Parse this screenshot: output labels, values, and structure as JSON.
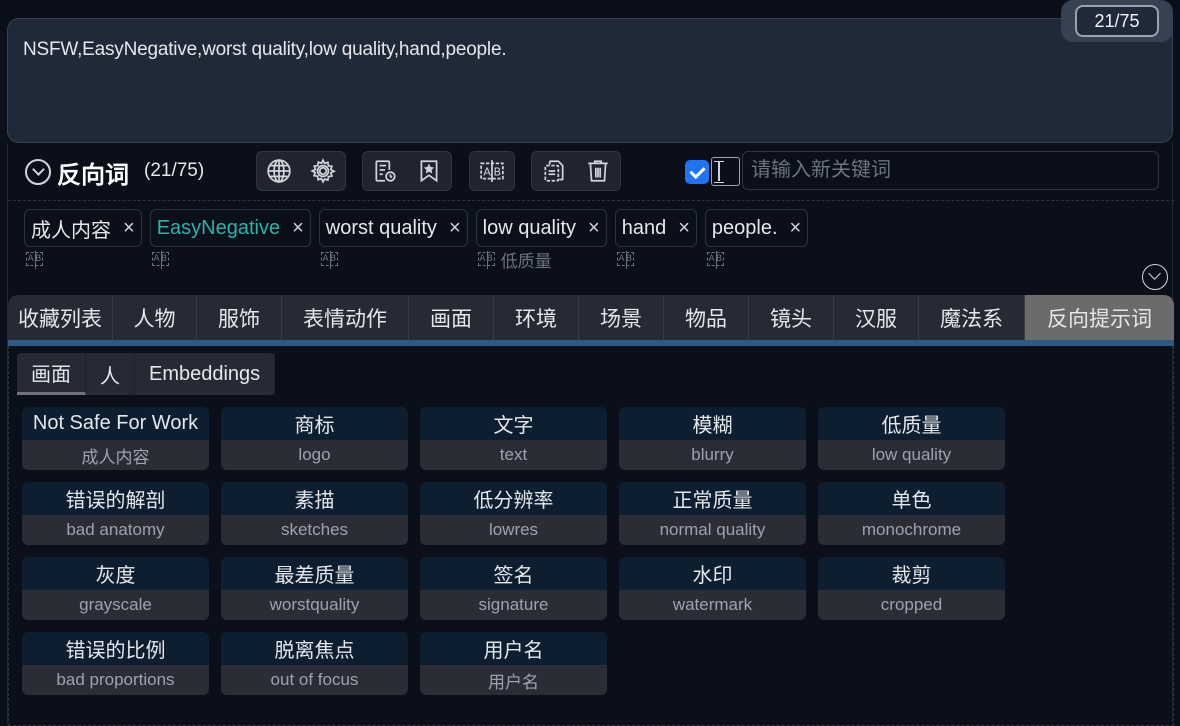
{
  "prompt": {
    "text": "NSFW,EasyNegative,worst quality,low quality,hand,people.",
    "counter": "21/75"
  },
  "header": {
    "title": "反向词",
    "count": "(21/75)",
    "input_placeholder": "请输入新关键词",
    "checkbox_checked": true
  },
  "tags": [
    {
      "label": "成人内容",
      "translation": "",
      "embedding": false
    },
    {
      "label": "EasyNegative",
      "translation": "",
      "embedding": true
    },
    {
      "label": "worst quality",
      "translation": "",
      "embedding": false
    },
    {
      "label": "low quality",
      "translation": "低质量",
      "embedding": false
    },
    {
      "label": "hand",
      "translation": "",
      "embedding": false
    },
    {
      "label": "people.",
      "translation": "",
      "embedding": false
    }
  ],
  "tag_close": "×",
  "ab_icon": {
    "a": "A",
    "b": "B"
  },
  "categories": [
    {
      "label": "收藏列表",
      "active": false
    },
    {
      "label": "人物",
      "active": false
    },
    {
      "label": "服饰",
      "active": false
    },
    {
      "label": "表情动作",
      "active": false
    },
    {
      "label": "画面",
      "active": false
    },
    {
      "label": "环境",
      "active": false
    },
    {
      "label": "场景",
      "active": false
    },
    {
      "label": "物品",
      "active": false
    },
    {
      "label": "镜头",
      "active": false
    },
    {
      "label": "汉服",
      "active": false
    },
    {
      "label": "魔法系",
      "active": false
    },
    {
      "label": "反向提示词",
      "active": true
    }
  ],
  "sub_tabs": [
    {
      "label": "画面",
      "active": true
    },
    {
      "label": "人",
      "active": false
    },
    {
      "label": "Embeddings",
      "active": false
    }
  ],
  "cards": [
    {
      "title": "Not Safe For Work",
      "sub": "成人内容"
    },
    {
      "title": "商标",
      "sub": "logo"
    },
    {
      "title": "文字",
      "sub": "text"
    },
    {
      "title": "模糊",
      "sub": "blurry"
    },
    {
      "title": "低质量",
      "sub": "low quality"
    },
    {
      "title": "错误的解剖",
      "sub": "bad anatomy"
    },
    {
      "title": "素描",
      "sub": "sketches"
    },
    {
      "title": "低分辨率",
      "sub": "lowres"
    },
    {
      "title": "正常质量",
      "sub": "normal quality"
    },
    {
      "title": "单色",
      "sub": "monochrome"
    },
    {
      "title": "灰度",
      "sub": "grayscale"
    },
    {
      "title": "最差质量",
      "sub": "worstquality"
    },
    {
      "title": "签名",
      "sub": "signature"
    },
    {
      "title": "水印",
      "sub": "watermark"
    },
    {
      "title": "裁剪",
      "sub": "cropped"
    },
    {
      "title": "错误的比例",
      "sub": "bad proportions"
    },
    {
      "title": "脱离焦点",
      "sub": "out of focus"
    },
    {
      "title": "用户名",
      "sub": "用户名"
    }
  ],
  "colors": {
    "accent_checkbox": "#1d74f5",
    "embedding_tag": "#2bb3a8",
    "active_category": "#6b6b6b",
    "category_bar": "#2a5a85"
  }
}
